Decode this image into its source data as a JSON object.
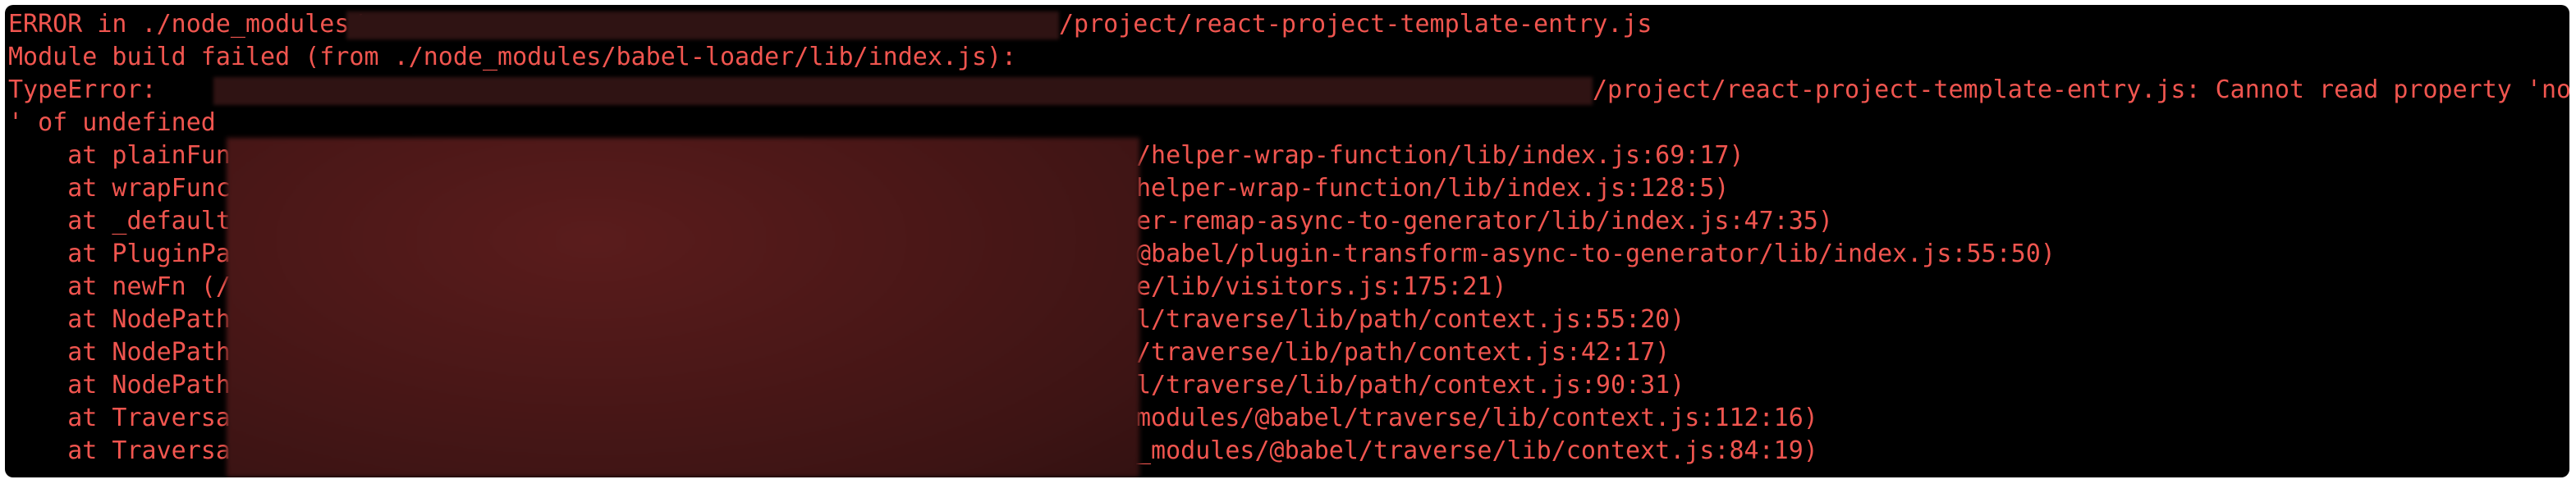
{
  "terminal": {
    "colors": {
      "background": "#000000",
      "error_text": "#f0554f",
      "redaction": "#3d1414"
    },
    "lines": [
      {
        "prefix": "ERROR in ./node_modules/",
        "suffix": "/project/react-project-template-entry.js"
      },
      {
        "text": "Module build failed (from ./node_modules/babel-loader/lib/index.js):"
      },
      {
        "prefix": "TypeError: ",
        "suffix": "/project/react-project-template-entry.js: Cannot read property 'node"
      },
      {
        "text": "' of undefined"
      }
    ],
    "stack": [
      {
        "head": "    at plainFun",
        "tail": "/helper-wrap-function/lib/index.js:69:17)"
      },
      {
        "head": "    at wrapFunc",
        "tail": "helper-wrap-function/lib/index.js:128:5)"
      },
      {
        "head": "    at _default",
        "tail": "er-remap-async-to-generator/lib/index.js:47:35)"
      },
      {
        "head": "    at PluginPa",
        "tail": "@babel/plugin-transform-async-to-generator/lib/index.js:55:50)"
      },
      {
        "head": "    at newFn (/",
        "tail": "e/lib/visitors.js:175:21)"
      },
      {
        "head": "    at NodePath",
        "tail": "l/traverse/lib/path/context.js:55:20)"
      },
      {
        "head": "    at NodePath",
        "tail": "/traverse/lib/path/context.js:42:17)"
      },
      {
        "head": "    at NodePath",
        "tail": "l/traverse/lib/path/context.js:90:31)"
      },
      {
        "head": "    at Traversa",
        "tail": "modules/@babel/traverse/lib/context.js:112:16)"
      },
      {
        "head": "    at Traversa",
        "tail": "_modules/@babel/traverse/lib/context.js:84:19)"
      }
    ]
  }
}
